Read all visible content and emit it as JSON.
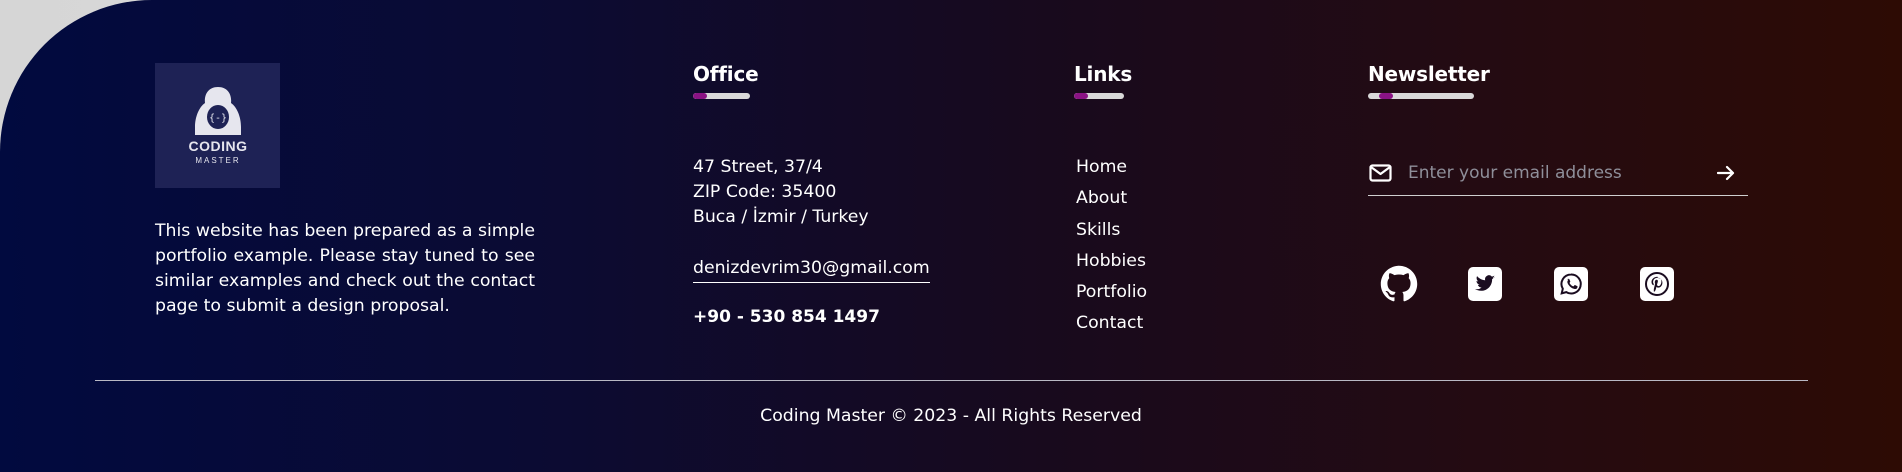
{
  "about": {
    "logo_text_line1": "CODING",
    "logo_text_line2": "MASTER",
    "logo_glyph": "{-}",
    "description": "This website has been prepared as a simple portfolio example. Please stay tuned to see similar examples and check out the contact page to submit a design proposal."
  },
  "office": {
    "title": "Office",
    "address_line1": "47 Street, 37/4",
    "address_line2": "ZIP Code: 35400",
    "address_line3": "Buca / İzmir / Turkey",
    "email": "denizdevrim30@gmail.com",
    "phone": "+90 - 530 854 1497"
  },
  "links": {
    "title": "Links",
    "items": [
      "Home",
      "About",
      "Skills",
      "Hobbies",
      "Portfolio",
      "Contact"
    ]
  },
  "newsletter": {
    "title": "Newsletter",
    "email_placeholder": "Enter your email address",
    "icons": {
      "field": "envelope-icon",
      "submit": "arrow-right-icon"
    }
  },
  "social": {
    "icons": [
      "github-icon",
      "twitter-icon",
      "whatsapp-icon",
      "pinterest-icon"
    ]
  },
  "footer": {
    "copyright": "Coding Master © 2023 - All Rights Reserved"
  },
  "colors": {
    "accent": "#8a1384",
    "gradient_start": "#010a3f",
    "gradient_end": "#2d0b04",
    "logo_bg": "#1e2255"
  }
}
